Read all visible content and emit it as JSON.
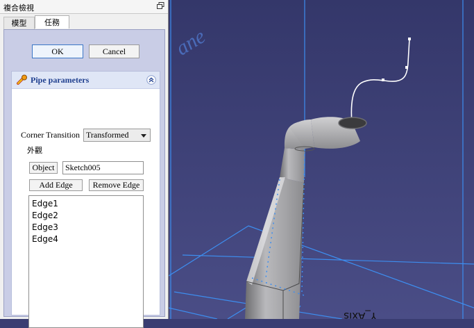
{
  "panel": {
    "title": "複合檢視",
    "tabs": [
      "模型",
      "任務"
    ],
    "active_tab": "任務"
  },
  "dialog": {
    "ok_label": "OK",
    "cancel_label": "Cancel"
  },
  "pipe": {
    "title": "Pipe parameters",
    "corner_transition_label": "Corner Transition",
    "corner_transition_value": "Transformed",
    "appearance_label": "外觀",
    "object_button": "Object",
    "object_value": "Sketch005",
    "add_edge_button": "Add Edge",
    "remove_edge_button": "Remove Edge",
    "edges": [
      "Edge1",
      "Edge2",
      "Edge3",
      "Edge4"
    ]
  },
  "viewport": {
    "plane_label": "ane",
    "y_axis_label": "Y_Axis",
    "colors": {
      "background": "#3a3d72",
      "axis": "#3d8ef0",
      "pipe": "#a9a9ab"
    }
  }
}
